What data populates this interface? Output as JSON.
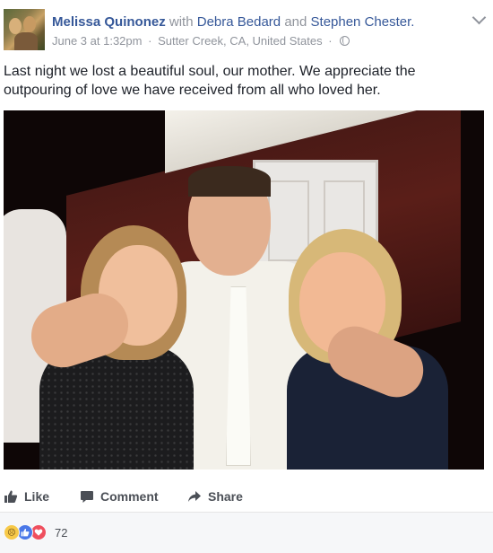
{
  "post": {
    "author": "Melissa Quinonez",
    "with_word": "with",
    "tagged_1": "Debra Bedard",
    "and_word": "and",
    "tagged_2": "Stephen Chester.",
    "date": "June 3 at 1:32pm",
    "location": "Sutter Creek, CA, United States",
    "separator": "·",
    "privacy_icon": "globe-icon",
    "menu_icon": "chevron-down-icon",
    "text": "Last night we lost a beautiful soul, our mother. We appreciate the outpouring of love we have received from all who loved her."
  },
  "actions": {
    "like_label": "Like",
    "comment_label": "Comment",
    "share_label": "Share",
    "like_icon": "thumbs-up-icon",
    "comment_icon": "speech-bubble-icon",
    "share_icon": "share-arrow-icon"
  },
  "reactions": {
    "icons": [
      "sad-reaction-icon",
      "like-reaction-icon",
      "love-reaction-icon"
    ],
    "count": "72",
    "colors": {
      "sad": "#f7c948",
      "like": "#4a78e8",
      "love": "#ef4f5e"
    }
  },
  "colors": {
    "link": "#365899",
    "meta": "#90949c",
    "text": "#1d2129",
    "action": "#4b4f56",
    "footer_bg": "#f6f7f9"
  }
}
